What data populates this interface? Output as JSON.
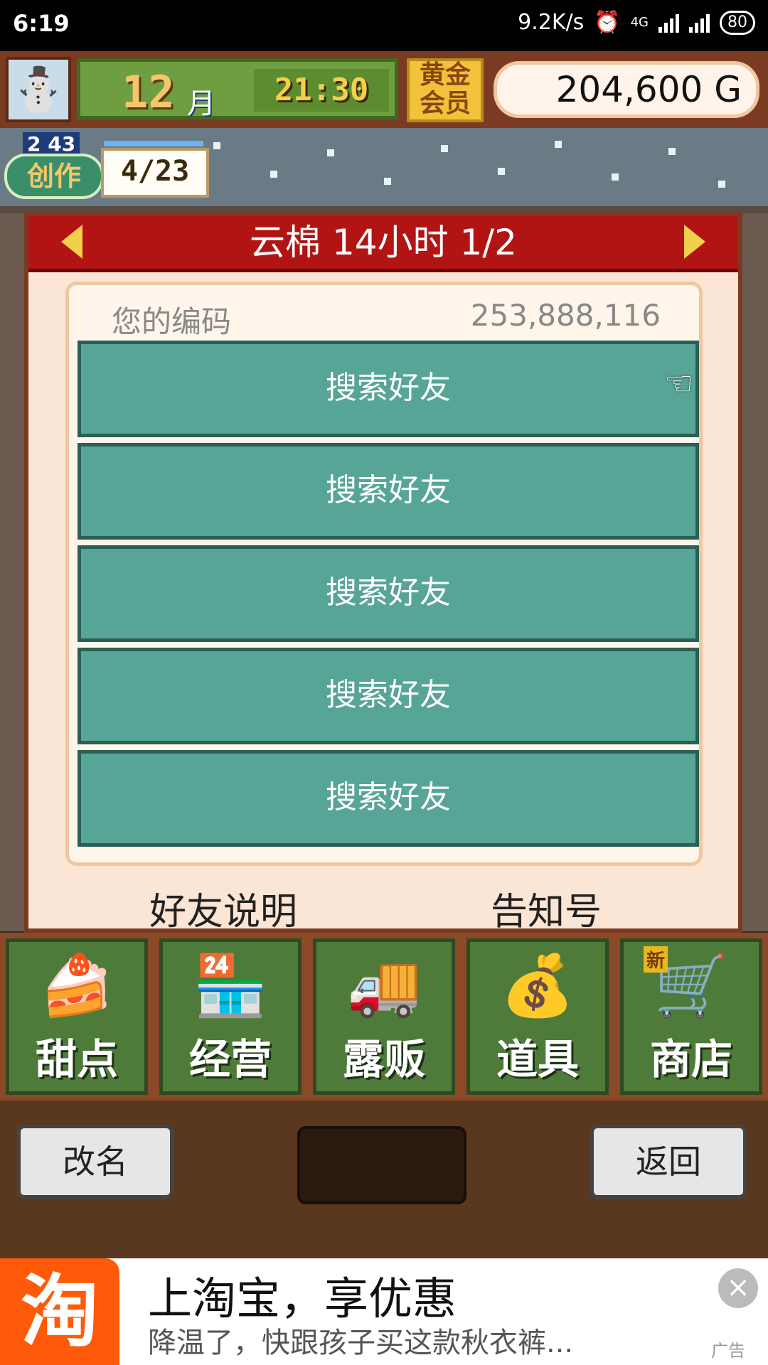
{
  "status_bar": {
    "time": "6:19",
    "network_speed": "9.2K/s",
    "network_type": "4G",
    "battery": "80"
  },
  "hud": {
    "month": "12",
    "month_unit": "月",
    "clock": "21:30",
    "gold_member": "黄金会员",
    "money": "204,600 G"
  },
  "creation": {
    "level": "2 43",
    "label": "创作",
    "count": "4/23"
  },
  "dialog": {
    "title": "云棉  14小时 1/2",
    "code_label": "您的编码",
    "code_value": "253,888,116",
    "friend_slots": [
      "搜索好友",
      "搜索好友",
      "搜索好友",
      "搜索好友",
      "搜索好友"
    ],
    "friend_help": "好友说明",
    "notice_id": "告知号"
  },
  "menu": [
    {
      "label": "甜点",
      "icon": "cake-icon"
    },
    {
      "label": "经营",
      "icon": "shop-icon"
    },
    {
      "label": "露贩",
      "icon": "food-truck-icon"
    },
    {
      "label": "道具",
      "icon": "items-bag-icon"
    },
    {
      "label": "商店",
      "icon": "cart-icon",
      "badge": "新"
    }
  ],
  "bottom": {
    "rename_label": "改名",
    "back_label": "返回"
  },
  "ad": {
    "logo": "淘",
    "title": "上淘宝，享优惠",
    "subtitle": "降温了，快跟孩子买这款秋衣裤...",
    "close": "×",
    "tag": "广告"
  }
}
